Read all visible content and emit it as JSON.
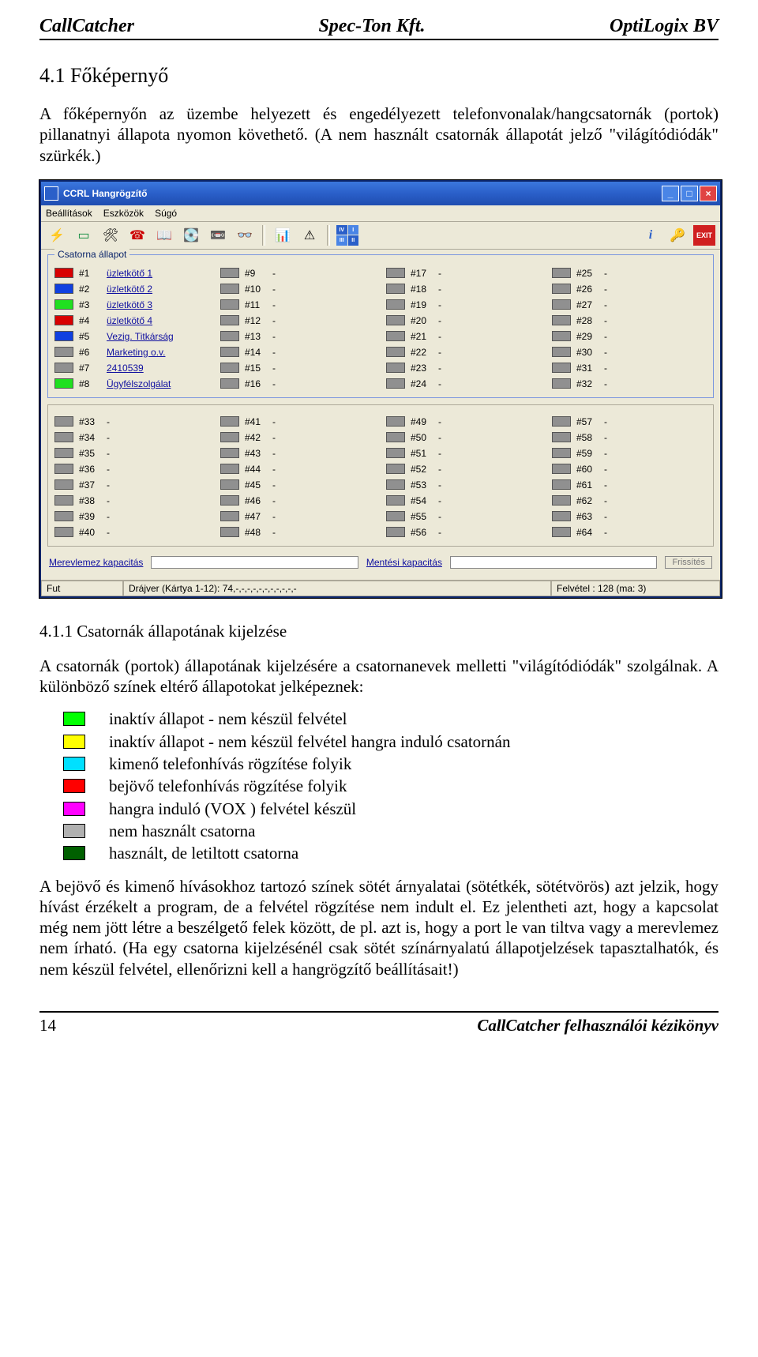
{
  "header": {
    "left": "CallCatcher",
    "center": "Spec-Ton Kft.",
    "right": "OptiLogix BV"
  },
  "section": {
    "number_title": "4.1   Főképernyő"
  },
  "para1": "A főképernyőn az üzembe helyezett és engedélyezett telefonvonalak/hangcsatornák (portok) pillanatnyi állapota nyomon követhető. (A nem használt csatornák állapotát jelző \"világítódiódák\" szürkék.)",
  "app": {
    "title": "CCRL Hangrögzítő",
    "menus": [
      "Beállítások",
      "Eszközök",
      "Súgó"
    ],
    "groupbox_title": "Csatorna állapot",
    "capacity": {
      "disk_label": "Merevlemez kapacitás",
      "save_label": "Mentési kapacitás",
      "refresh": "Frissítés"
    },
    "status": {
      "c1": "Fut",
      "c2": "Drájver (Kártya 1-12): 74,-,-,-,-,-,-,-,-,-,-,-",
      "c3": "Felvétel : 128 (ma: 3)"
    },
    "channels_top": [
      {
        "n": "#1",
        "name": "üzletkötő 1",
        "color": "#d80000"
      },
      {
        "n": "#2",
        "name": "üzletkötő 2",
        "color": "#1040e0"
      },
      {
        "n": "#3",
        "name": "üzletkötő 3",
        "color": "#20e020"
      },
      {
        "n": "#4",
        "name": "üzletkötő 4",
        "color": "#d80000"
      },
      {
        "n": "#5",
        "name": "Vezig. Titkárság",
        "color": "#1040e0"
      },
      {
        "n": "#6",
        "name": "Marketing o.v.",
        "color": "#909090"
      },
      {
        "n": "#7",
        "name": "2410539",
        "color": "#909090"
      },
      {
        "n": "#8",
        "name": "Ügyfélszolgálat",
        "color": "#20e020"
      }
    ],
    "gray_col2": [
      "#9",
      "#10",
      "#11",
      "#12",
      "#13",
      "#14",
      "#15",
      "#16"
    ],
    "gray_col3": [
      "#17",
      "#18",
      "#19",
      "#20",
      "#21",
      "#22",
      "#23",
      "#24"
    ],
    "gray_col4": [
      "#25",
      "#26",
      "#27",
      "#28",
      "#29",
      "#30",
      "#31",
      "#32"
    ],
    "lower_cols": [
      [
        "#33",
        "#34",
        "#35",
        "#36",
        "#37",
        "#38",
        "#39",
        "#40"
      ],
      [
        "#41",
        "#42",
        "#43",
        "#44",
        "#45",
        "#46",
        "#47",
        "#48"
      ],
      [
        "#49",
        "#50",
        "#51",
        "#52",
        "#53",
        "#54",
        "#55",
        "#56"
      ],
      [
        "#57",
        "#58",
        "#59",
        "#60",
        "#61",
        "#62",
        "#63",
        "#64"
      ]
    ]
  },
  "subsection": {
    "title": "4.1.1   Csatornák állapotának kijelzése"
  },
  "para2": "A csatornák (portok) állapotának kijelzésére a csatornanevek melletti \"világítódiódák\" szolgálnak. A különböző színek eltérő állapotokat jelképeznek:",
  "legend_items": [
    {
      "color": "#00ff00",
      "text": "inaktív állapot - nem készül felvétel"
    },
    {
      "color": "#ffff00",
      "text": "inaktív állapot - nem készül felvétel hangra induló csatornán"
    },
    {
      "color": "#00e0ff",
      "text": "kimenő telefonhívás rögzítése folyik"
    },
    {
      "color": "#ff0000",
      "text": "bejövő telefonhívás rögzítése folyik"
    },
    {
      "color": "#ff00ff",
      "text": "hangra induló (VOX ) felvétel készül"
    },
    {
      "color": "#b0b0b0",
      "text": "nem használt csatorna"
    },
    {
      "color": "#006000",
      "text": "használt, de letiltott csatorna"
    }
  ],
  "para3": "A bejövő és kimenő hívásokhoz tartozó színek sötét árnyalatai (sötétkék, sötétvörös) azt jelzik, hogy hívást érzékelt a program, de a felvétel rögzítése nem indult el. Ez jelentheti azt, hogy a kapcsolat még nem jött létre a beszélgető felek között, de pl. azt is, hogy a port le van tiltva vagy a merevlemez nem írható. (Ha egy csatorna kijelzésénél csak sötét színárnyalatú állapotjelzések tapasztalhatók, és nem készül felvétel, ellenőrizni kell a hangrögzítő beállításait!)",
  "footer": {
    "left": "14",
    "right": "CallCatcher felhasználói kézikönyv"
  }
}
